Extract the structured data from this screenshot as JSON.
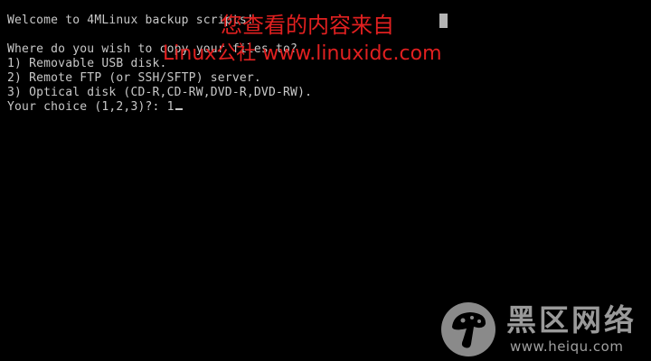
{
  "terminal": {
    "lines": [
      "Welcome to 4MLinux backup scripts!",
      "",
      "Where do you wish to copy your files to?",
      "1) Removable USB disk.",
      "2) Remote FTP (or SSH/SFTP) server.",
      "3) Optical disk (CD-R,CD-RW,DVD-R,DVD-RW).",
      "Your choice (1,2,3)?: 1"
    ]
  },
  "watermark": {
    "line1": "您查看的内容来自",
    "line2": "Linux公社 www.linuxidc.com"
  },
  "logo": {
    "name": "黑区网络",
    "url": "www.heiqu.com",
    "icon": "mushroom-icon"
  },
  "colors": {
    "background": "#000000",
    "terminal_text": "#c8c8c8",
    "watermark": "#e02020",
    "logo": "#8a8a8a"
  }
}
